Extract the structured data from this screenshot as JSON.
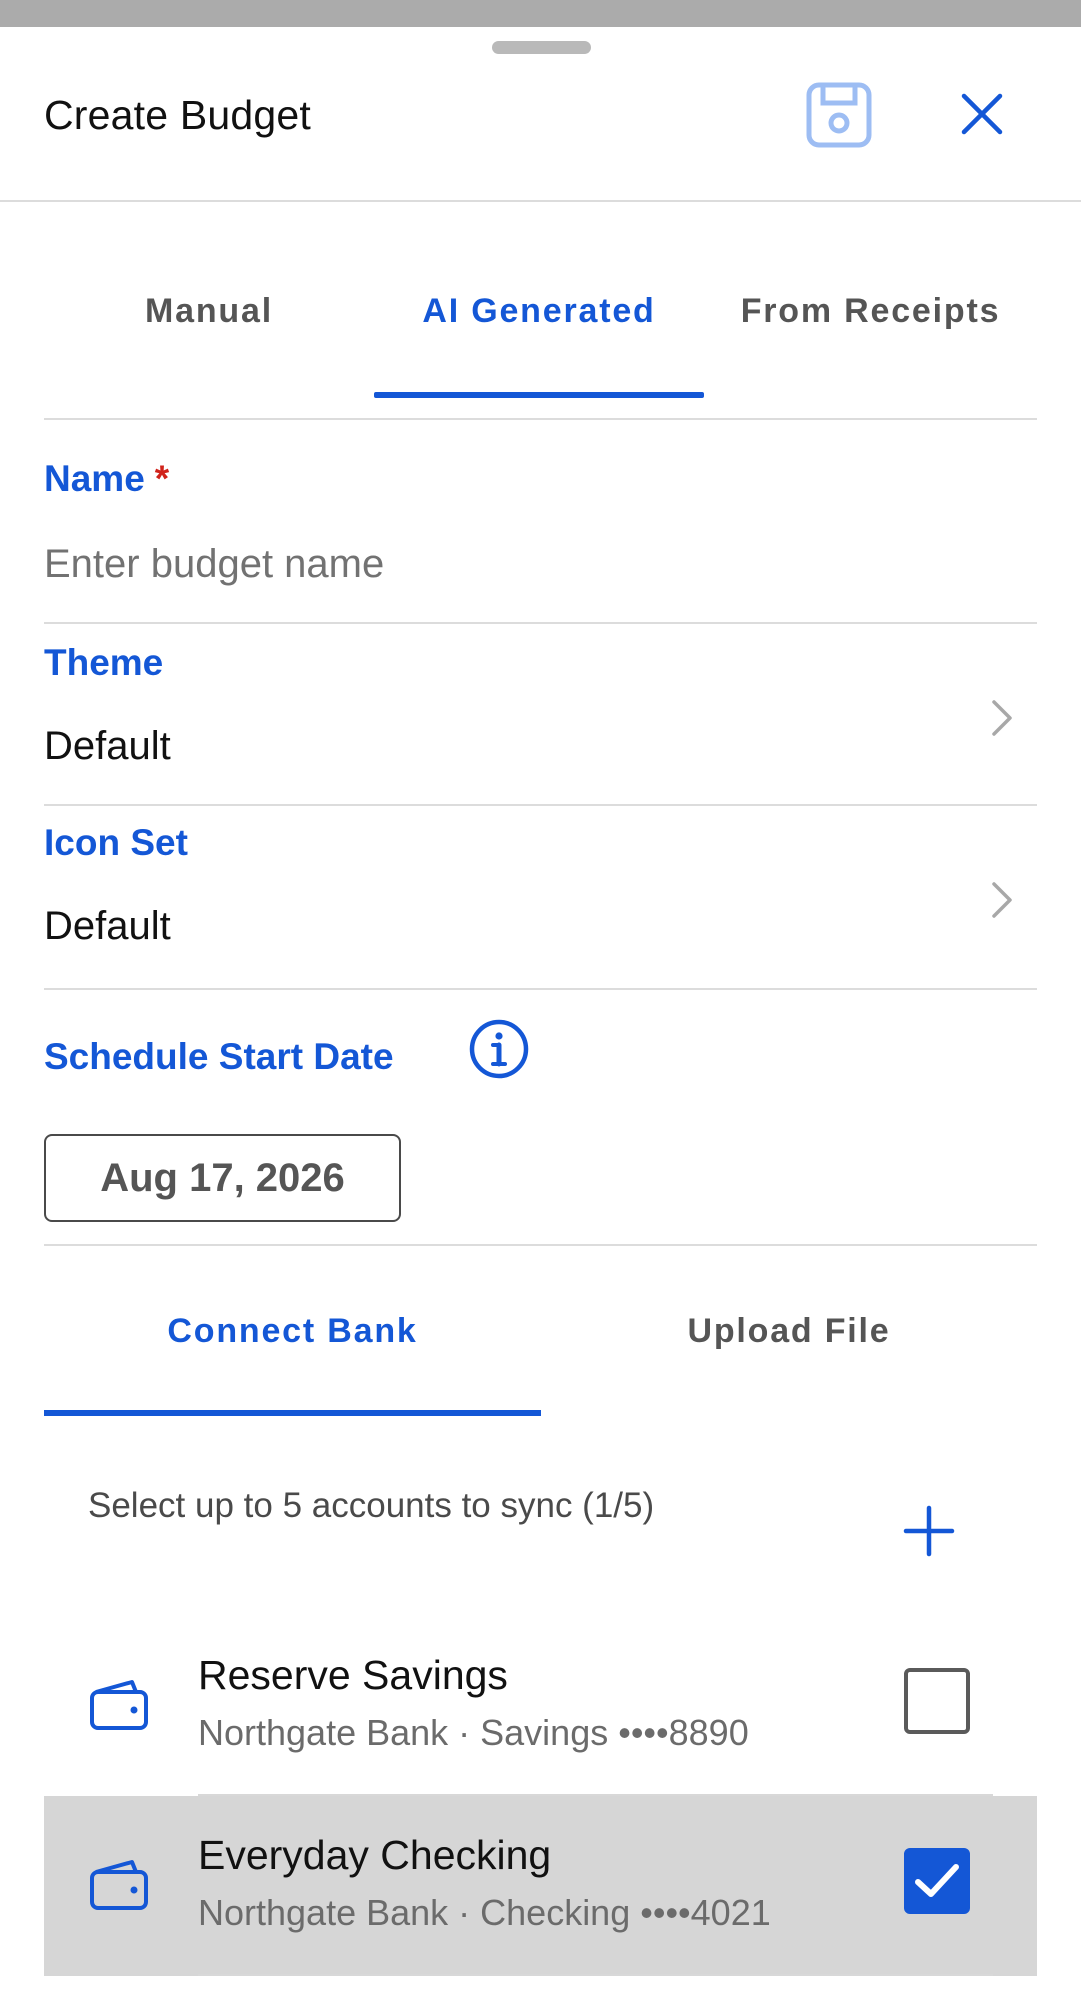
{
  "header": {
    "title": "Create Budget",
    "save_icon": "save-icon",
    "close_icon": "close-icon"
  },
  "tabs": [
    {
      "label": "Manual",
      "active": false
    },
    {
      "label": "AI Generated",
      "active": true
    },
    {
      "label": "From Receipts",
      "active": false
    }
  ],
  "form": {
    "name": {
      "label": "Name",
      "required_mark": "*",
      "placeholder": "Enter budget name",
      "value": ""
    },
    "theme": {
      "label": "Theme",
      "value": "Default"
    },
    "icon_set": {
      "label": "Icon Set",
      "value": "Default"
    },
    "schedule": {
      "label": "Schedule Start Date",
      "value": "Aug 17, 2026"
    }
  },
  "source_tabs": [
    {
      "label": "Connect Bank",
      "active": true
    },
    {
      "label": "Upload File",
      "active": false
    }
  ],
  "sync": {
    "instructions": "Select up to 5 accounts to sync (1/5)",
    "add_icon": "plus-icon"
  },
  "accounts": [
    {
      "name": "Reserve Savings",
      "detail": "Northgate Bank · Savings ••••8890",
      "checked": false
    },
    {
      "name": "Everyday Checking",
      "detail": "Northgate Bank · Checking ••••4021",
      "checked": true
    }
  ],
  "colors": {
    "accent": "#1457d6",
    "required": "#d0231b",
    "selected_row": "#d6d6d6",
    "divider": "#dcdcdc"
  }
}
